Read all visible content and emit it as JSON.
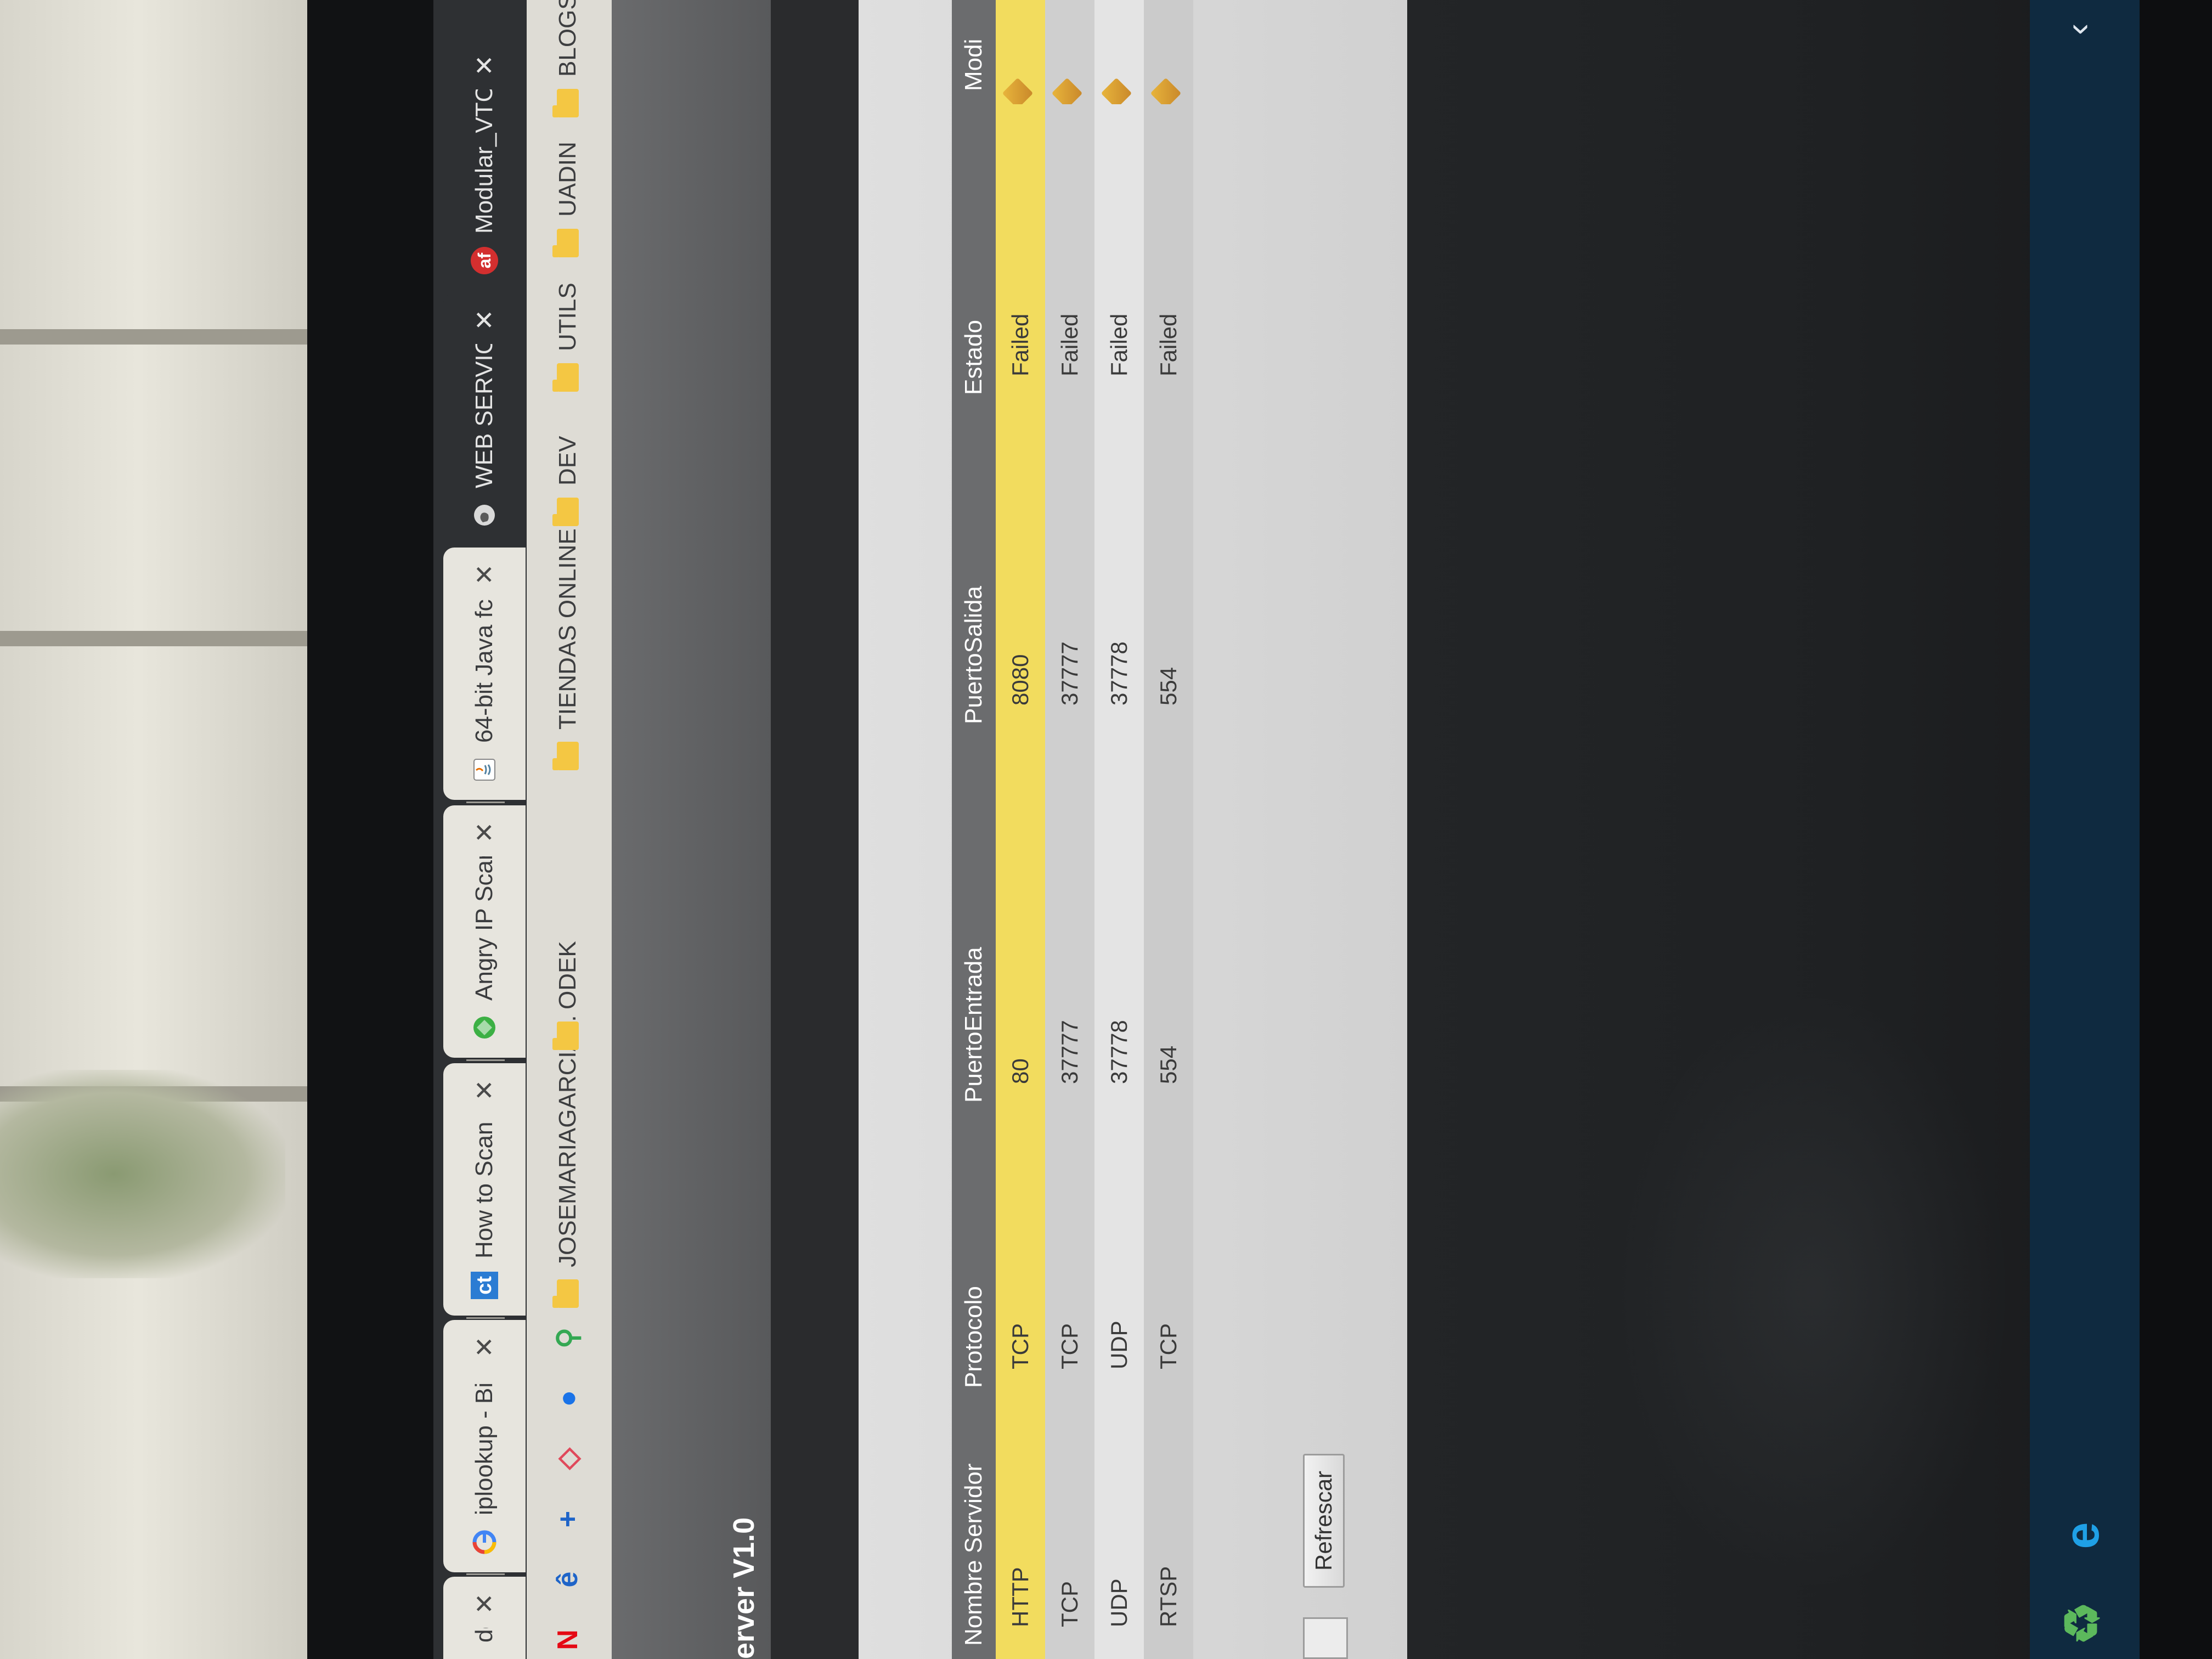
{
  "tabs": [
    {
      "label": "de s",
      "icon": "page-icon"
    },
    {
      "label": "iplookup - Bi",
      "icon": "google-icon"
    },
    {
      "label": "How to Scan",
      "icon": "ct-icon"
    },
    {
      "label": "Angry IP Scar",
      "icon": "angry-ip-icon"
    },
    {
      "label": "64-bit Java fc",
      "icon": "java-icon"
    },
    {
      "label": "WEB SERVICE",
      "icon": "globe-icon"
    },
    {
      "label": "Modular_VTC",
      "icon": "af-icon"
    }
  ],
  "tab_close_glyph": "✕",
  "bookmarks": [
    {
      "label": "JOSEMARIAGARCIA...",
      "icon": "folder-icon"
    },
    {
      "label": "ODEK",
      "icon": "folder-icon"
    },
    {
      "label": "TIENDAS ONLINE",
      "icon": "folder-icon"
    },
    {
      "label": "DEV",
      "icon": "folder-icon"
    },
    {
      "label": "UTILS",
      "icon": "folder-icon"
    },
    {
      "label": "UADIN",
      "icon": "folder-icon"
    },
    {
      "label": "BLOGS",
      "icon": "folder-icon"
    }
  ],
  "bookmark_icons": [
    {
      "name": "netflix-icon",
      "glyph": "N",
      "color": "#e50914"
    },
    {
      "name": "edge-like-icon",
      "glyph": "ê",
      "color": "#1e64c8"
    },
    {
      "name": "plus-icon",
      "glyph": "+",
      "color": "#1e64c8"
    },
    {
      "name": "airbnb-icon",
      "glyph": "◇",
      "color": "#e0495b"
    },
    {
      "name": "drive-icon",
      "glyph": "●",
      "color": "#1a73e8"
    },
    {
      "name": "maps-pin-icon",
      "glyph": "⚲",
      "color": "#34a853"
    }
  ],
  "app": {
    "title": "erver V1.0"
  },
  "table": {
    "headers": [
      "Nombre Servidor",
      "Protocolo",
      "PuertoEntrada",
      "PuertoSalida",
      "Estado",
      "Modi"
    ],
    "rows": [
      {
        "name": "HTTP",
        "protocol": "TCP",
        "in_port": "80",
        "out_port": "8080",
        "status": "Failed"
      },
      {
        "name": "TCP",
        "protocol": "TCP",
        "in_port": "37777",
        "out_port": "37777",
        "status": "Failed"
      },
      {
        "name": "UDP",
        "protocol": "UDP",
        "in_port": "37778",
        "out_port": "37778",
        "status": "Failed"
      },
      {
        "name": "RTSP",
        "protocol": "TCP",
        "in_port": "554",
        "out_port": "554",
        "status": "Failed"
      }
    ],
    "highlight_color": "#f2dc5e"
  },
  "buttons": {
    "refresh_label": "Refrescar"
  },
  "taskbar": {
    "icons": [
      {
        "name": "recycle-icon",
        "glyph": "♻",
        "color": "#5cb85c"
      },
      {
        "name": "internet-explorer-icon",
        "glyph": "e",
        "color": "#1fa0e6"
      }
    ],
    "tray_chevron": "‹"
  }
}
